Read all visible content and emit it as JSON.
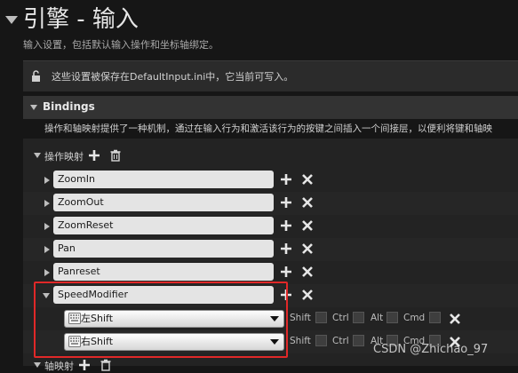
{
  "header": {
    "title": "引擎 - 输入",
    "subtitle": "输入设置，包括默认输入操作和坐标轴绑定。"
  },
  "notice": {
    "text": "这些设置被保存在DefaultInput.ini中，它当前可写入。"
  },
  "bindings": {
    "title": "Bindings",
    "description": "操作和轴映射提供了一种机制，通过在输入行为和激活该行为的按键之间插入一个间接层，以便利将键和轴映",
    "action_mappings_label": "操作映射",
    "axis_mappings_label": "轴映射",
    "actions": [
      {
        "name": "ZoomIn"
      },
      {
        "name": "ZoomOut"
      },
      {
        "name": "ZoomReset"
      },
      {
        "name": "Pan"
      },
      {
        "name": "Panreset"
      },
      {
        "name": "SpeedModifier"
      }
    ],
    "speed_modifier_keys": [
      {
        "key": "左Shift",
        "modifiers": {
          "shift": "Shift",
          "ctrl": "Ctrl",
          "alt": "Alt",
          "cmd": "Cmd"
        }
      },
      {
        "key": "右Shift",
        "modifiers": {
          "shift": "Shift",
          "ctrl": "Ctrl",
          "alt": "Alt",
          "cmd": "Cmd"
        }
      }
    ]
  },
  "watermark": "CSDN @Zhichao_97",
  "colors": {
    "background": "#161616",
    "highlight": "#e02828",
    "field": "#e4e4e4"
  }
}
